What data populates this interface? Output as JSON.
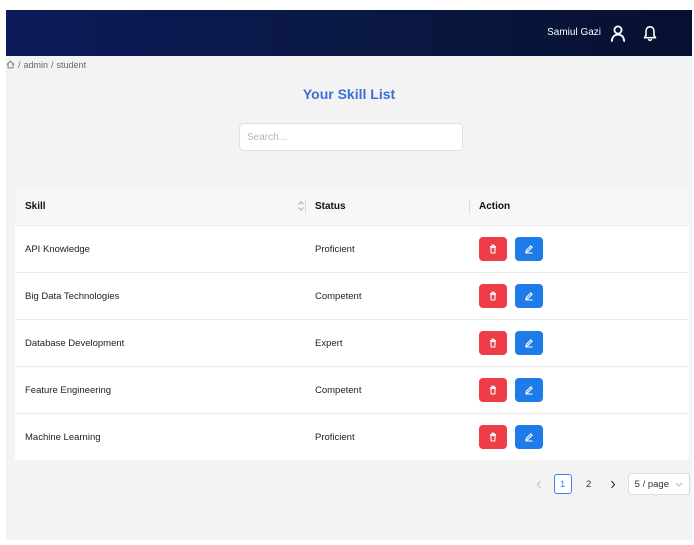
{
  "header": {
    "user_name": "Samiul Gazi",
    "gradient_start": "#0c1a5a",
    "gradient_end": "#061030"
  },
  "breadcrumb": {
    "items": [
      "admin",
      "student"
    ],
    "separator": "/"
  },
  "page": {
    "title": "Your Skill List",
    "title_color": "#3b6fd8"
  },
  "search": {
    "placeholder": "Search...",
    "value": ""
  },
  "table": {
    "columns": [
      "Skill",
      "Status",
      "Action"
    ],
    "rows": [
      {
        "skill": "API Knowledge",
        "status": "Proficient"
      },
      {
        "skill": "Big Data Technologies",
        "status": "Competent"
      },
      {
        "skill": "Database Development",
        "status": "Expert"
      },
      {
        "skill": "Feature Engineering",
        "status": "Competent"
      },
      {
        "skill": "Machine Learning",
        "status": "Proficient"
      }
    ],
    "delete_color": "#ee3d47",
    "edit_color": "#1e7ce8"
  },
  "pagination": {
    "pages": [
      "1",
      "2"
    ],
    "current": "1",
    "page_size": "5 / page"
  }
}
